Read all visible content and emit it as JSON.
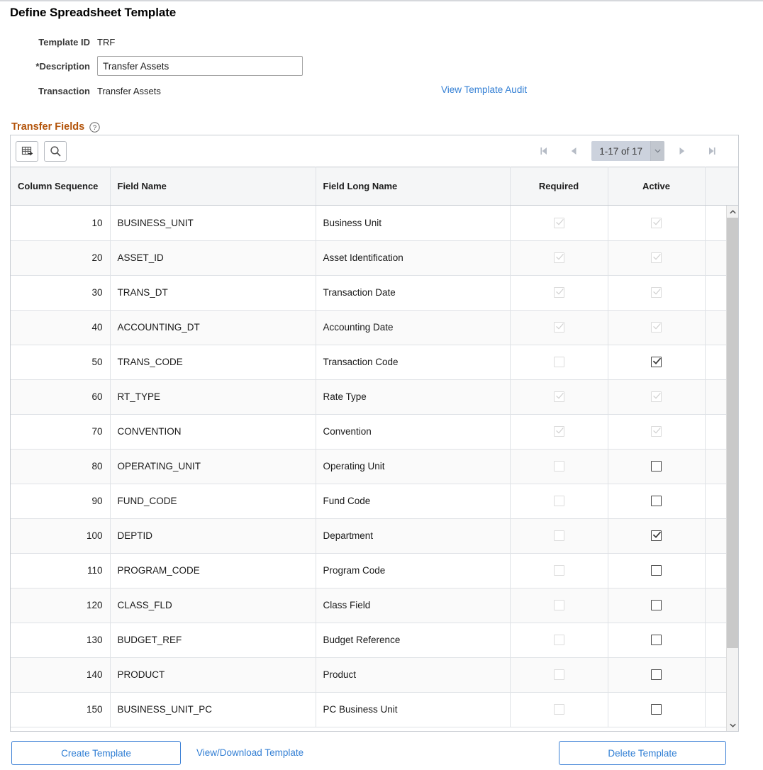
{
  "page": {
    "title": "Define Spreadsheet Template"
  },
  "form": {
    "template_id_label": "Template ID",
    "template_id_value": "TRF",
    "description_label": "*Description",
    "description_value": "Transfer Assets",
    "description_placeholder": "",
    "transaction_label": "Transaction",
    "transaction_value": "Transfer Assets",
    "audit_link": "View Template Audit"
  },
  "section": {
    "title": "Transfer Fields",
    "help_icon": "question-mark-icon"
  },
  "toolbar": {
    "personalize_icon": "grid-personalize-icon",
    "find_icon": "search-icon",
    "pager": {
      "first_icon": "first-page-icon",
      "prev_icon": "previous-page-icon",
      "range_text": "1-17 of 17",
      "dropdown_icon": "chevron-down-icon",
      "next_icon": "next-page-icon",
      "last_icon": "last-page-icon"
    }
  },
  "grid": {
    "columns": [
      "Column Sequence",
      "Field Name",
      "Field Long Name",
      "Required",
      "Active"
    ],
    "rows": [
      {
        "seq": "10",
        "field": "BUSINESS_UNIT",
        "long": "Business Unit",
        "required_checked": true,
        "required_enabled": false,
        "active_checked": true,
        "active_enabled": false
      },
      {
        "seq": "20",
        "field": "ASSET_ID",
        "long": "Asset Identification",
        "required_checked": true,
        "required_enabled": false,
        "active_checked": true,
        "active_enabled": false
      },
      {
        "seq": "30",
        "field": "TRANS_DT",
        "long": "Transaction Date",
        "required_checked": true,
        "required_enabled": false,
        "active_checked": true,
        "active_enabled": false
      },
      {
        "seq": "40",
        "field": "ACCOUNTING_DT",
        "long": "Accounting Date",
        "required_checked": true,
        "required_enabled": false,
        "active_checked": true,
        "active_enabled": false
      },
      {
        "seq": "50",
        "field": "TRANS_CODE",
        "long": "Transaction Code",
        "required_checked": false,
        "required_enabled": false,
        "active_checked": true,
        "active_enabled": true
      },
      {
        "seq": "60",
        "field": "RT_TYPE",
        "long": "Rate Type",
        "required_checked": true,
        "required_enabled": false,
        "active_checked": true,
        "active_enabled": false
      },
      {
        "seq": "70",
        "field": "CONVENTION",
        "long": "Convention",
        "required_checked": true,
        "required_enabled": false,
        "active_checked": true,
        "active_enabled": false
      },
      {
        "seq": "80",
        "field": "OPERATING_UNIT",
        "long": "Operating Unit",
        "required_checked": false,
        "required_enabled": false,
        "active_checked": false,
        "active_enabled": true
      },
      {
        "seq": "90",
        "field": "FUND_CODE",
        "long": "Fund Code",
        "required_checked": false,
        "required_enabled": false,
        "active_checked": false,
        "active_enabled": true
      },
      {
        "seq": "100",
        "field": "DEPTID",
        "long": "Department",
        "required_checked": false,
        "required_enabled": false,
        "active_checked": true,
        "active_enabled": true
      },
      {
        "seq": "110",
        "field": "PROGRAM_CODE",
        "long": "Program Code",
        "required_checked": false,
        "required_enabled": false,
        "active_checked": false,
        "active_enabled": true
      },
      {
        "seq": "120",
        "field": "CLASS_FLD",
        "long": "Class Field",
        "required_checked": false,
        "required_enabled": false,
        "active_checked": false,
        "active_enabled": true
      },
      {
        "seq": "130",
        "field": "BUDGET_REF",
        "long": "Budget Reference",
        "required_checked": false,
        "required_enabled": false,
        "active_checked": false,
        "active_enabled": true
      },
      {
        "seq": "140",
        "field": "PRODUCT",
        "long": "Product",
        "required_checked": false,
        "required_enabled": false,
        "active_checked": false,
        "active_enabled": true
      },
      {
        "seq": "150",
        "field": "BUSINESS_UNIT_PC",
        "long": "PC Business Unit",
        "required_checked": false,
        "required_enabled": false,
        "active_checked": false,
        "active_enabled": true
      }
    ]
  },
  "scrollbar": {
    "up_icon": "scroll-up-icon",
    "down_icon": "scroll-down-icon"
  },
  "footer": {
    "create_label": "Create Template",
    "download_label": "View/Download Template",
    "delete_label": "Delete Template"
  },
  "colors": {
    "accent_link": "#337fd4",
    "section_title": "#b35309",
    "button_border": "#3a7fd5",
    "header_bg": "#f5f6f7",
    "row_alt_bg": "#fafafa",
    "pager_bg": "#ccd2dd"
  }
}
